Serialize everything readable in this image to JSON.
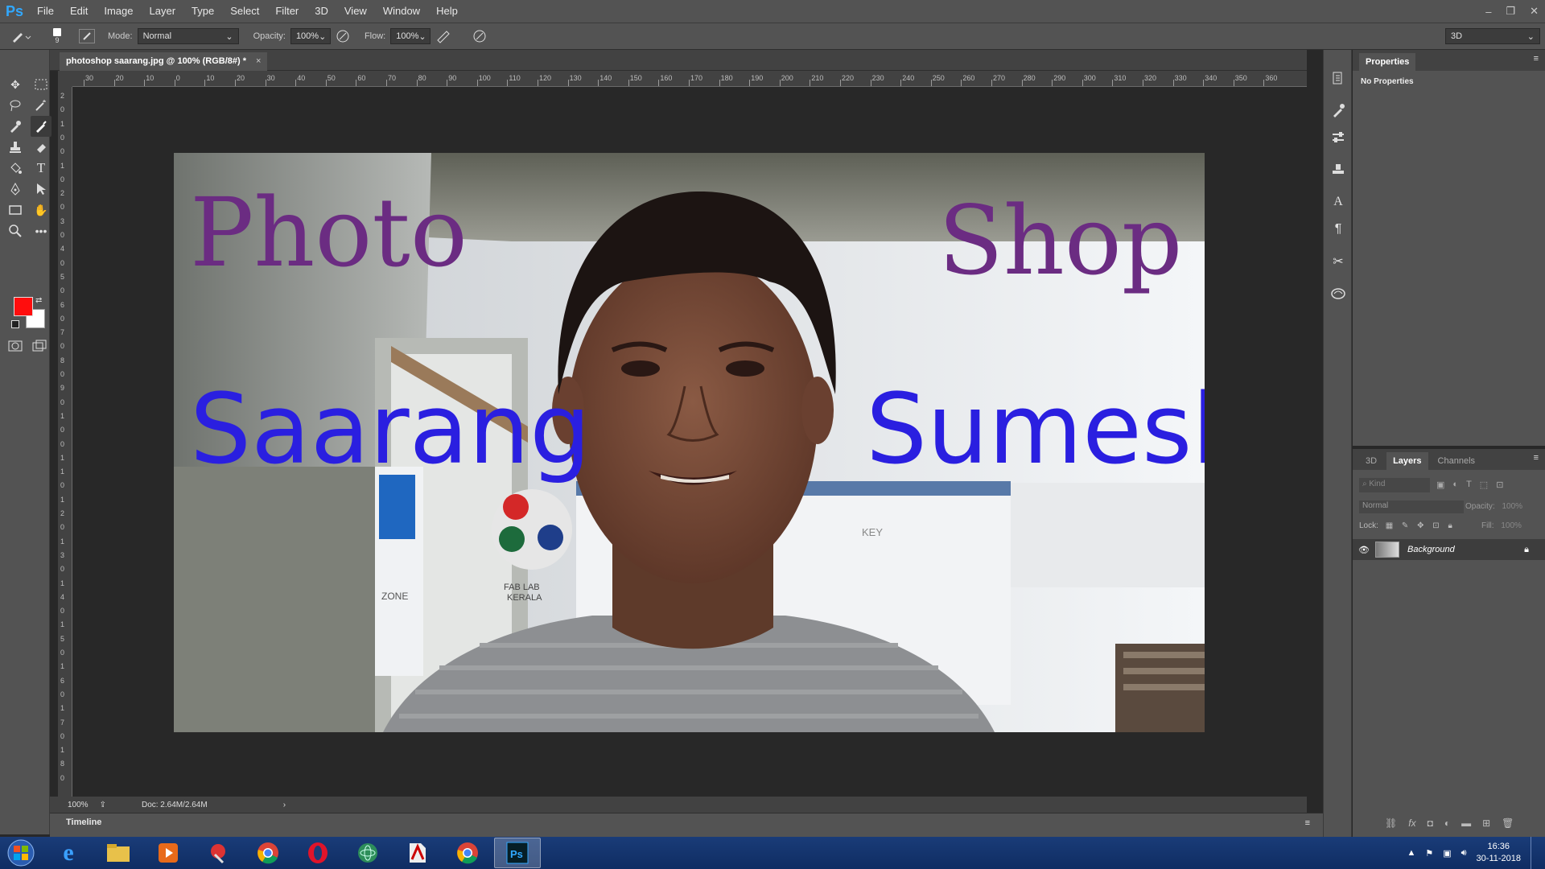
{
  "app": {
    "logo": "Ps"
  },
  "menu": [
    "File",
    "Edit",
    "Image",
    "Layer",
    "Type",
    "Select",
    "Filter",
    "3D",
    "View",
    "Window",
    "Help"
  ],
  "window_controls": {
    "minimize": "–",
    "restore": "❐",
    "close": "✕"
  },
  "options": {
    "brush_size": "9",
    "mode_label": "Mode:",
    "mode_value": "Normal",
    "opacity_label": "Opacity:",
    "opacity_value": "100%",
    "flow_label": "Flow:",
    "flow_value": "100%",
    "workspace": "3D"
  },
  "document": {
    "tab_title": "photoshop saarang.jpg @ 100% (RGB/8#) *",
    "close": "×"
  },
  "ruler": {
    "h_labels": [
      "30",
      "20",
      "10",
      "0",
      "10",
      "20",
      "30",
      "40",
      "50",
      "60",
      "70",
      "80",
      "90",
      "100",
      "110",
      "120",
      "130",
      "140",
      "150",
      "160",
      "170",
      "180",
      "190",
      "200",
      "210",
      "220",
      "230",
      "240",
      "250",
      "260",
      "270",
      "280",
      "290",
      "300",
      "310",
      "320",
      "330",
      "340",
      "350",
      "360"
    ],
    "v_labels": [
      "2",
      "0",
      "1",
      "0",
      "0",
      "1",
      "0",
      "2",
      "0",
      "3",
      "0",
      "4",
      "0",
      "5",
      "0",
      "6",
      "0",
      "7",
      "0",
      "8",
      "0",
      "9",
      "0",
      "1",
      "0",
      "0",
      "1",
      "1",
      "0",
      "1",
      "2",
      "0",
      "1",
      "3",
      "0",
      "1",
      "4",
      "0",
      "1",
      "5",
      "0",
      "1",
      "6",
      "0",
      "1",
      "7",
      "0",
      "1",
      "8",
      "0"
    ]
  },
  "image_text": {
    "photo": "Photo",
    "shop": "Shop",
    "saarang": "Saarang",
    "sumesh": "Sumesh",
    "fab_lab": "FAB LAB",
    "kerala": "KERALA",
    "key": "KEY",
    "zone": "ZONE"
  },
  "colors": {
    "foreground": "#ff0d0d",
    "background": "#ffffff",
    "purple_text": "#6b2c82",
    "blue_text": "#2a1fe0",
    "accent": "#31a8ff"
  },
  "status": {
    "zoom": "100%",
    "doc": "Doc: 2.64M/2.64M",
    "arrow": "›"
  },
  "timeline": "Timeline",
  "properties": {
    "title": "Properties",
    "message": "No Properties"
  },
  "layers": {
    "tabs": [
      "3D",
      "Layers",
      "Channels"
    ],
    "kind_placeholder": "Kind",
    "blend_mode": "Normal",
    "opacity_label": "Opacity:",
    "opacity_value": "100%",
    "lock_label": "Lock:",
    "fill_label": "Fill:",
    "fill_value": "100%",
    "layer_name": "Background"
  },
  "taskbar": {
    "apps": [
      "start-orb",
      "internet-explorer",
      "file-explorer",
      "media-player",
      "paint-tool",
      "chrome",
      "opera",
      "atom",
      "acrobat",
      "chrome-2",
      "photoshop"
    ],
    "time": "16:36",
    "date": "30-11-2018"
  }
}
